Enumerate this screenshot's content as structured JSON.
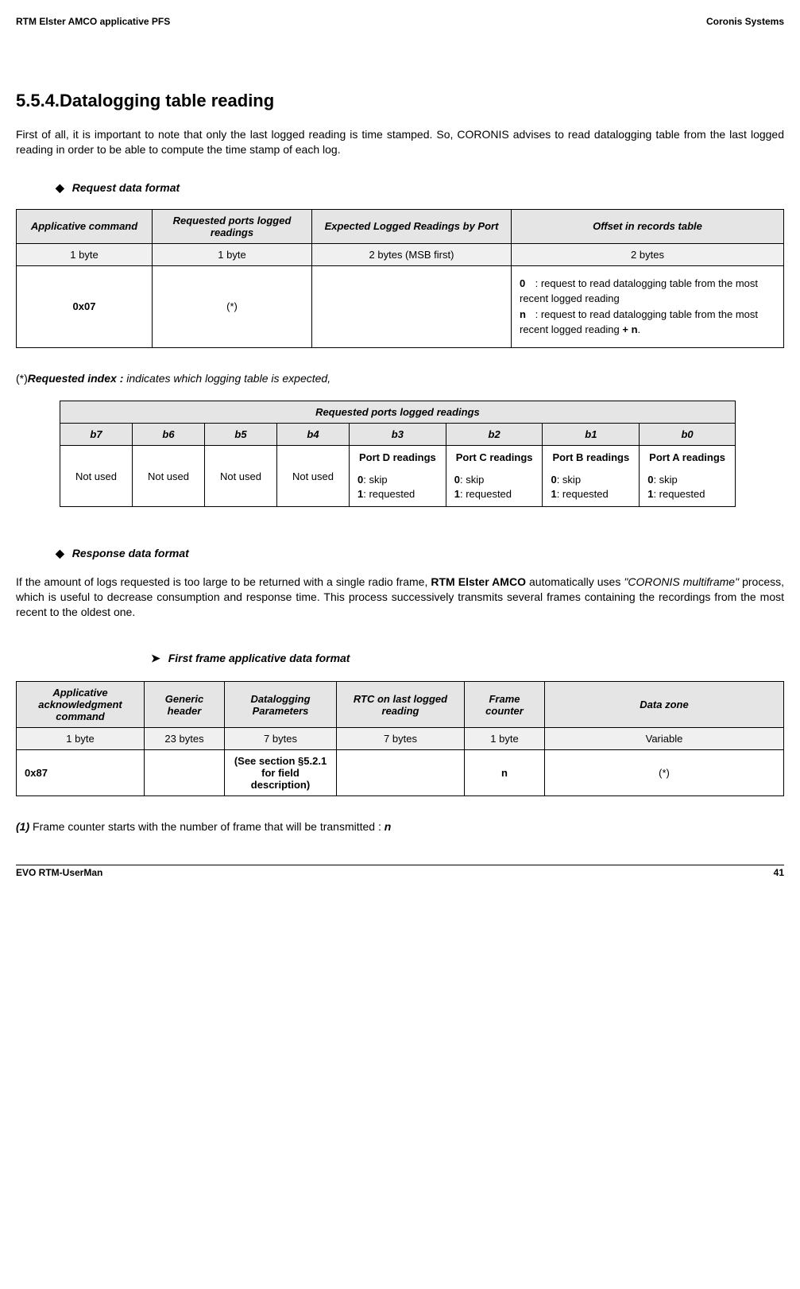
{
  "header": {
    "left": "RTM Elster AMCO applicative PFS",
    "right": "Coronis Systems"
  },
  "footer": {
    "left": "EVO RTM-UserMan",
    "right": "41"
  },
  "section": {
    "number": "5.5.4.",
    "title": "Datalogging table reading"
  },
  "intro": "First of all, it is important to note that only the last logged reading is time stamped. So, CORONIS advises to read datalogging table from the last logged reading in order to be able to compute the time stamp of each log.",
  "request_title": "Request data format",
  "table1": {
    "headers": [
      "Applicative command",
      "Requested ports logged readings",
      "Expected Logged Readings by Port",
      "Offset in records table"
    ],
    "sizes": [
      "1 byte",
      "1 byte",
      "2 bytes (MSB first)",
      "2 bytes"
    ],
    "row": {
      "cmd": "0x07",
      "ports": "(*)",
      "expected": "",
      "offset": {
        "k0": "0",
        "d0": ": request to read datalogging table from the most recent logged reading",
        "k1": "n",
        "d1": ": request to read datalogging table from the most recent logged reading ",
        "plusn": "+ n",
        "d1end": "."
      }
    }
  },
  "requested_index": {
    "star": "(*)",
    "label": "Requested index :",
    "desc": " indicates which logging table is expected,"
  },
  "table2": {
    "caption": "Requested ports logged readings",
    "bits": [
      "b7",
      "b6",
      "b5",
      "b4",
      "b3",
      "b2",
      "b1",
      "b0"
    ],
    "hi": [
      "Not used",
      "Not used",
      "Not used",
      "Not used"
    ],
    "ports": [
      {
        "title": "Port D readings",
        "skip": "0: skip",
        "req": "1: requested"
      },
      {
        "title": "Port C readings",
        "skip": "0: skip",
        "req": "1: requested"
      },
      {
        "title": "Port B readings",
        "skip": "0: skip",
        "req": "1: requested"
      },
      {
        "title": "Port A readings",
        "skip": "0: skip",
        "req": "1: requested"
      }
    ]
  },
  "response_title": "Response data format",
  "response_para_a": "If the amount of logs requested is too large to be returned with a single radio frame, ",
  "response_para_b": "RTM Elster AMCO",
  "response_para_c": " automatically uses ",
  "response_para_d": "\"CORONIS multiframe\"",
  "response_para_e": " process, which is useful to decrease consumption and response time. This process successively transmits several frames containing the recordings from the most recent to the oldest one.",
  "first_frame_title": "First frame applicative data format",
  "table3": {
    "headers": [
      "Applicative acknowledgment command",
      "Generic header",
      "Datalogging Parameters",
      "RTC on last logged reading",
      "Frame counter",
      "Data zone"
    ],
    "sizes": [
      "1 byte",
      "23 bytes",
      "7 bytes",
      "7 bytes",
      "1 byte",
      "Variable"
    ],
    "row": {
      "cmd": "0x87",
      "gen": "",
      "params": "(See section §5.2.1 for field description)",
      "rtc": "",
      "fc": "n",
      "dz": "(*)"
    }
  },
  "note": {
    "num": "(1)",
    "text": "  Frame counter starts with the number of frame that will be transmitted : ",
    "n": "n"
  }
}
